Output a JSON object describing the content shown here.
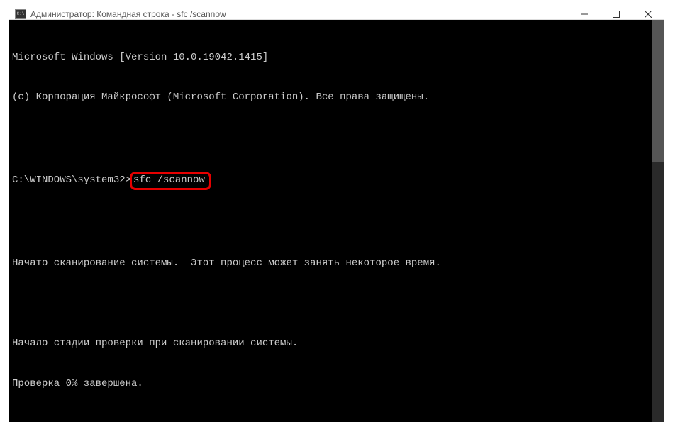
{
  "window": {
    "title": "Администратор: Командная строка - sfc  /scannow"
  },
  "terminal": {
    "line1": "Microsoft Windows [Version 10.0.19042.1415]",
    "line2": "(c) Корпорация Майкрософт (Microsoft Corporation). Все права защищены.",
    "prompt": "C:\\WINDOWS\\system32>",
    "command": "sfc /scannow",
    "line4": "Начато сканирование системы.  Этот процесс может занять некоторое время.",
    "line5": "Начало стадии проверки при сканировании системы.",
    "line6": "Проверка 0% завершена."
  },
  "icons": {
    "minimize": "minimize",
    "maximize": "maximize",
    "close": "close"
  }
}
